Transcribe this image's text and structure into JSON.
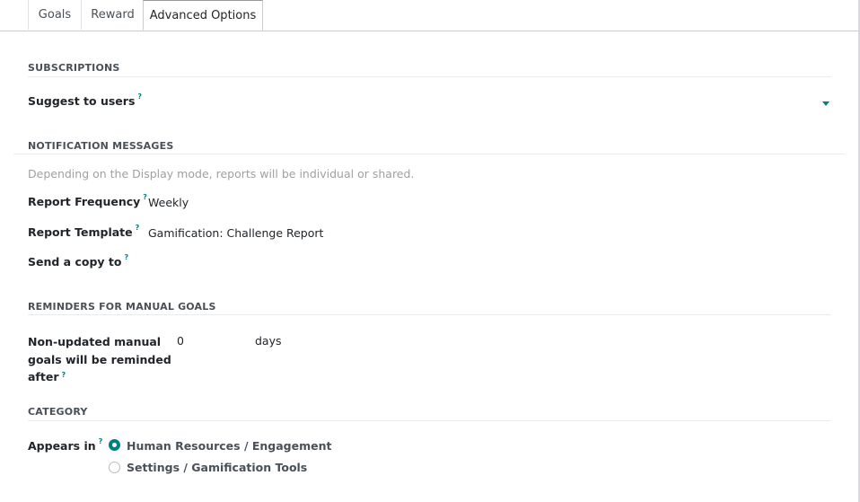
{
  "tabs": [
    {
      "label": "Goals",
      "active": false
    },
    {
      "label": "Reward",
      "active": false
    },
    {
      "label": "Advanced Options",
      "active": true
    }
  ],
  "subscriptions": {
    "title": "SUBSCRIPTIONS",
    "suggest_label": "Suggest to users",
    "suggest_value": ""
  },
  "notifications": {
    "title": "NOTIFICATION MESSAGES",
    "hint": "Depending on the Display mode, reports will be individual or shared.",
    "report_frequency_label": "Report Frequency",
    "report_frequency_value": "Weekly",
    "report_template_label": "Report Template",
    "report_template_value": "Gamification: Challenge Report",
    "send_copy_label": "Send a copy to",
    "send_copy_value": ""
  },
  "reminders": {
    "title": "REMINDERS FOR MANUAL GOALS",
    "label_line1": "Non-updated manual",
    "label_line2": "goals will be reminded",
    "label_line3": "after",
    "value": "0",
    "unit": "days"
  },
  "category": {
    "title": "CATEGORY",
    "appears_in_label": "Appears in",
    "options": [
      {
        "label": "Human Resources / Engagement",
        "checked": true
      },
      {
        "label": "Settings / Gamification Tools",
        "checked": false
      }
    ]
  },
  "help_marker": "?",
  "colors": {
    "accent": "#017e84"
  }
}
